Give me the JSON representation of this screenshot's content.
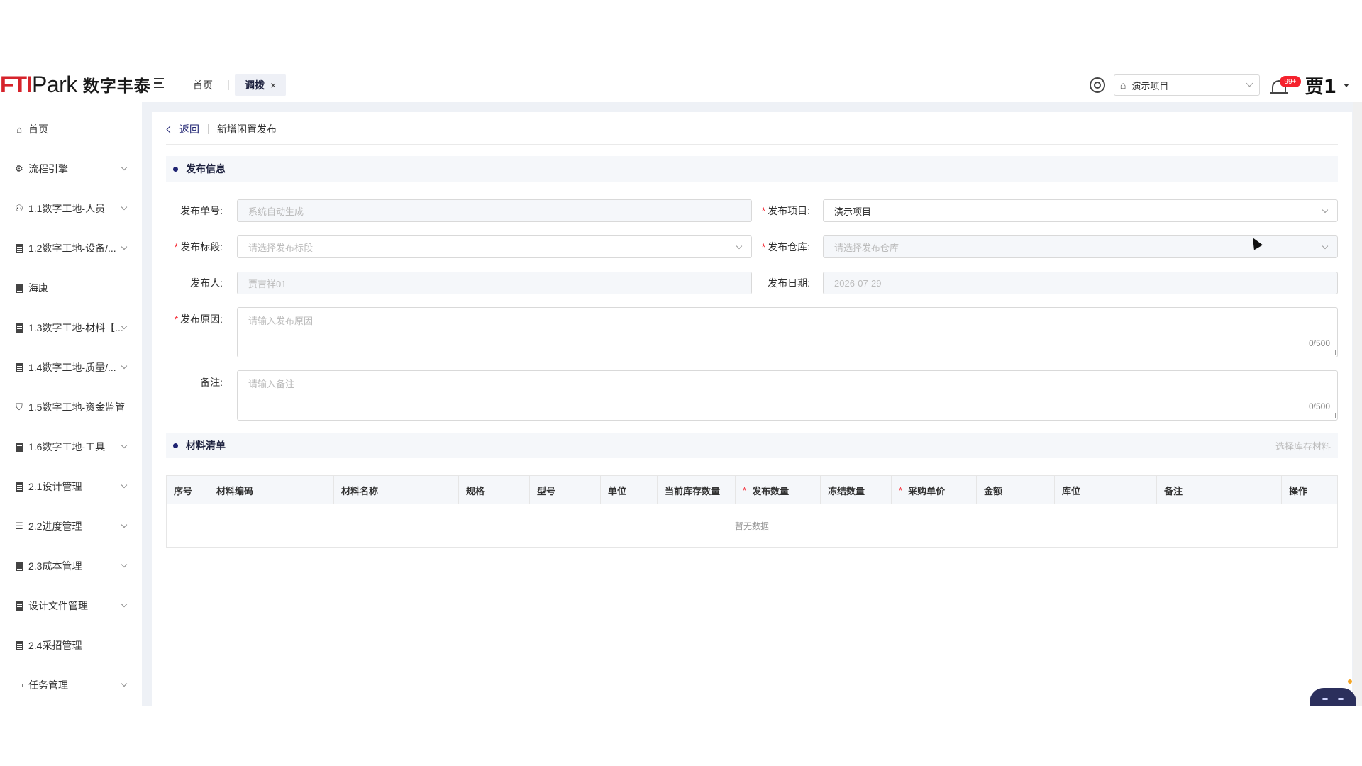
{
  "header": {
    "logo_mark": "FTI",
    "logo_park": "Park",
    "logo_cn": "数字丰泰",
    "tabs": [
      {
        "label": "首页",
        "active": false
      },
      {
        "label": "调拨",
        "active": true,
        "close": "×"
      }
    ],
    "project_select": "演示项目",
    "notification_badge": "99+",
    "user_name": "贾1"
  },
  "sidebar": {
    "items": [
      {
        "label": "首页",
        "icon": "home-icon",
        "expandable": false
      },
      {
        "label": "流程引擎",
        "icon": "workflow-icon",
        "expandable": true
      },
      {
        "label": "1.1数字工地-人员",
        "icon": "people-icon",
        "expandable": true
      },
      {
        "label": "1.2数字工地-设备/...",
        "icon": "document-icon",
        "expandable": true
      },
      {
        "label": "海康",
        "icon": "document-icon",
        "expandable": false
      },
      {
        "label": "1.3数字工地-材料【...",
        "icon": "document-icon",
        "expandable": true
      },
      {
        "label": "1.4数字工地-质量/...",
        "icon": "document-icon",
        "expandable": true
      },
      {
        "label": "1.5数字工地-资金监管",
        "icon": "shield-icon",
        "expandable": false
      },
      {
        "label": "1.6数字工地-工具",
        "icon": "document-icon",
        "expandable": true
      },
      {
        "label": "2.1设计管理",
        "icon": "document-icon",
        "expandable": true
      },
      {
        "label": "2.2进度管理",
        "icon": "gantt-icon",
        "expandable": true
      },
      {
        "label": "2.3成本管理",
        "icon": "document-icon",
        "expandable": true
      },
      {
        "label": "设计文件管理",
        "icon": "document-icon",
        "expandable": true
      },
      {
        "label": "2.4采招管理",
        "icon": "document-icon",
        "expandable": false
      },
      {
        "label": "任务管理",
        "icon": "briefcase-icon",
        "expandable": true
      }
    ]
  },
  "breadcrumb": {
    "back": "返回",
    "title": "新增闲置发布"
  },
  "sections": {
    "info": "发布信息",
    "materials": "材料清单",
    "materials_action": "选择库存材料"
  },
  "form": {
    "order_no": {
      "label": "发布单号:",
      "placeholder": "系统自动生成"
    },
    "project": {
      "label": "发布项目:",
      "value": "演示项目",
      "required": true
    },
    "section": {
      "label": "发布标段:",
      "placeholder": "请选择发布标段",
      "required": true
    },
    "warehouse": {
      "label": "发布仓库:",
      "placeholder": "请选择发布仓库",
      "required": true
    },
    "publisher": {
      "label": "发布人:",
      "value": "贾吉祥01"
    },
    "date": {
      "label": "发布日期:",
      "value": "2026-07-29"
    },
    "reason": {
      "label": "发布原因:",
      "placeholder": "请输入发布原因",
      "count": "0/500",
      "required": true
    },
    "remark": {
      "label": "备注:",
      "placeholder": "请输入备注",
      "count": "0/500"
    }
  },
  "table": {
    "columns": [
      {
        "label": "序号",
        "required": false
      },
      {
        "label": "材料编码",
        "required": false
      },
      {
        "label": "材料名称",
        "required": false
      },
      {
        "label": "规格",
        "required": false
      },
      {
        "label": "型号",
        "required": false
      },
      {
        "label": "单位",
        "required": false
      },
      {
        "label": "当前库存数量",
        "required": false
      },
      {
        "label": "发布数量",
        "required": true
      },
      {
        "label": "冻结数量",
        "required": false
      },
      {
        "label": "采购单价",
        "required": true
      },
      {
        "label": "金额",
        "required": false
      },
      {
        "label": "库位",
        "required": false
      },
      {
        "label": "备注",
        "required": false
      },
      {
        "label": "操作",
        "required": false
      }
    ],
    "empty_text": "暂无数据"
  },
  "colors": {
    "accent": "#1f2372",
    "required": "#f5222d",
    "badge": "#f5222d",
    "brand_red": "#d6232b"
  }
}
